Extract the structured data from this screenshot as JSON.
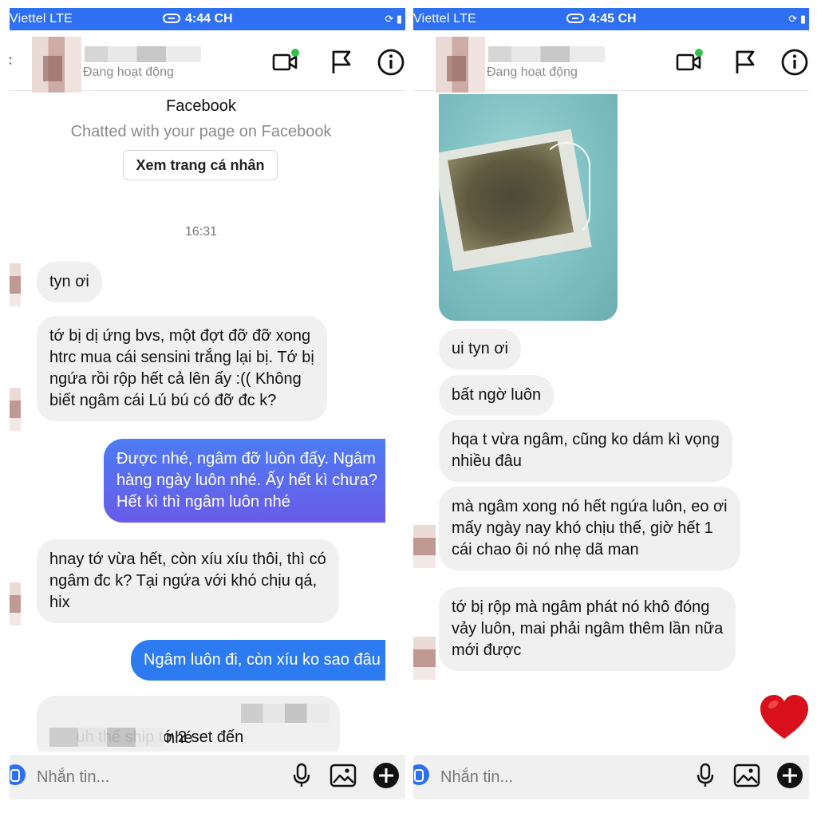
{
  "colors": {
    "accent": "#2f6ff2",
    "outgoing_bubble": "#5b6cf0",
    "incoming_bubble": "#f0f0f0",
    "heart": "#d8101c"
  },
  "left": {
    "status": {
      "carrier": "Viettel  LTE",
      "time": "4:44 CH"
    },
    "header": {
      "status_text": "Đang hoạt động"
    },
    "intro": {
      "title": "Facebook",
      "subtitle": "Chatted with your page on Facebook",
      "profile_button": "Xem trang cá nhân"
    },
    "timestamp": "16:31",
    "messages": [
      {
        "from": "them",
        "text": "tyn ơi"
      },
      {
        "from": "them",
        "text": "tớ bị dị ứng bvs, một đợt đỡ đỡ xong\nhtrc mua cái sensini trắng lại bị. Tớ bị\nngứa rồi rộp hết cả lên ấy :(( Không\nbiết ngâm cái Lú bú có đỡ đc k?"
      },
      {
        "from": "me",
        "text": "Được nhé, ngâm đỡ luôn đấy. Ngâm\nhàng ngày luôn nhé. Ấy hết kì chưa?\nHết kì thì ngâm luôn nhé"
      },
      {
        "from": "them",
        "text": "hnay tớ vừa hết, còn xíu xíu thôi, thì có\nngâm đc k? Tại ngứa với khó chịu qá,\nhix"
      },
      {
        "from": "me",
        "text": "Ngâm luôn đi, còn xíu ko sao đâu"
      },
      {
        "from": "them",
        "text_line1": "uh thế ship tớ 2 set đến",
        "text_line2_end": "nhé"
      }
    ],
    "composer": {
      "placeholder": "Nhắn tin..."
    }
  },
  "right": {
    "status": {
      "carrier": "Viettel  LTE",
      "time": "4:45 CH"
    },
    "header": {
      "status_text": "Đang hoạt động"
    },
    "messages": [
      {
        "from": "them",
        "text": "ui tyn ơi"
      },
      {
        "from": "them",
        "text": "bất ngờ luôn"
      },
      {
        "from": "them",
        "text": "hqa t vừa ngâm, cũng ko dám kì vọng\nnhiều đâu"
      },
      {
        "from": "them",
        "text": "mà ngâm xong nó hết ngứa luôn, eo ơi\nmấy ngày nay khó chịu thế, giờ hết 1\ncái chao ôi nó nhẹ dã man"
      },
      {
        "from": "them",
        "text": "tớ bị rộp mà ngâm phát nó khô đóng\nvảy luôn, mai phải ngâm thêm lần nữa\nmới được"
      }
    ],
    "reaction": "heart-icon",
    "composer": {
      "placeholder": "Nhắn tin..."
    }
  }
}
